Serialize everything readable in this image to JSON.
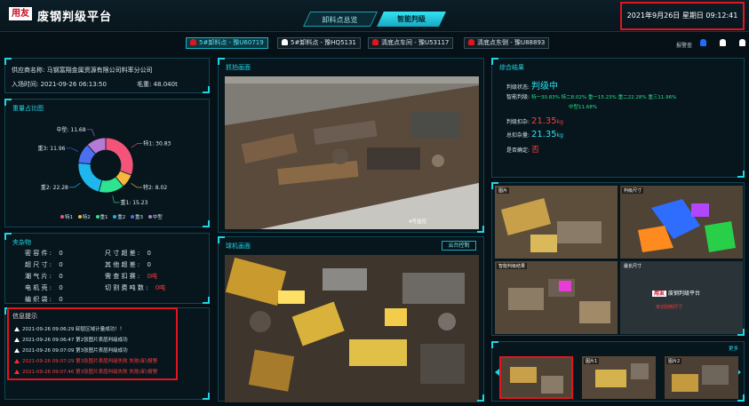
{
  "header": {
    "logo_text": "用友",
    "app_title": "废钢判级平台",
    "tabs": [
      {
        "label": "卸料点总览",
        "active": false
      },
      {
        "label": "智能判级",
        "active": true
      }
    ],
    "datetime": "2021年9月26日   星期日   09:12:41"
  },
  "subbar": {
    "plates": [
      {
        "label": "5#卸料点 - 豫U60719",
        "active": true,
        "bell": "#e3141e"
      },
      {
        "label": "5#卸料点 - 豫HQ5131",
        "active": false,
        "bell": "#ffffff"
      },
      {
        "label": "清底点车间 - 豫U53117",
        "active": false,
        "bell": "#e3141e"
      },
      {
        "label": "清底点东侧 - 豫U88893",
        "active": false,
        "bell": "#e3141e"
      }
    ],
    "right_label": "报警查"
  },
  "supplier": {
    "name_label": "供应商名称:",
    "name_value": "马钢富翔金属资源有限公司料率分公司",
    "time_label": "入场时间:",
    "time_value": "2021-09-26 06:13:50",
    "weight_label": "毛重:",
    "weight_value": "48.040t"
  },
  "ratio_panel": {
    "title": "重量占比图",
    "legend": [
      {
        "name": "特1",
        "color": "#f4537a"
      },
      {
        "name": "特2",
        "color": "#f6b73c"
      },
      {
        "name": "重1",
        "color": "#2ee48f"
      },
      {
        "name": "重2",
        "color": "#1fb6ee"
      },
      {
        "name": "重3",
        "color": "#4a6ff0"
      },
      {
        "name": "中型",
        "color": "#b57ad8"
      }
    ]
  },
  "chart_data": {
    "type": "pie",
    "title": "",
    "categories": [
      "特1",
      "特2",
      "重1",
      "重2",
      "重3",
      "中型"
    ],
    "values": [
      30.83,
      8.02,
      15.23,
      22.28,
      11.96,
      11.68
    ],
    "labels": [
      "特1: 30.83",
      "特2: 8.02",
      "重1: 15.23",
      "重2: 22.28",
      "重3: 11.96",
      "中型: 11.68"
    ],
    "legend": "bottom"
  },
  "inclusions": {
    "title": "夹杂物",
    "items": [
      {
        "label": "密 容 件 :",
        "value": "0",
        "color": "#d5e2e8"
      },
      {
        "label": "尺 寸 超 差 :",
        "value": "0",
        "color": "#d5e2e8"
      },
      {
        "label": "超 尺 寸 :",
        "value": "0",
        "color": "#d5e2e8"
      },
      {
        "label": "其 他 超 差 :",
        "value": "0",
        "color": "#d5e2e8"
      },
      {
        "label": "潮 气 片 :",
        "value": "0",
        "color": "#d5e2e8"
      },
      {
        "label": "需 查 扣 赛 :",
        "value": "0吨",
        "color": "#ff3b3b"
      },
      {
        "label": "电 机 壳 :",
        "value": "0",
        "color": "#d5e2e8"
      },
      {
        "label": "切 割 费 吨 数 :",
        "value": "0吨",
        "color": "#ff3b3b"
      },
      {
        "label": "编 织 袋 :",
        "value": "0",
        "color": "#d5e2e8"
      }
    ]
  },
  "messages": {
    "title": "信息提示",
    "items": [
      {
        "text": "2021-09-26 09:06:29   卸层区域计量成功！！",
        "level": "info"
      },
      {
        "text": "2021-09-26 09:06:47   第2张图片表层判级成功",
        "level": "info"
      },
      {
        "text": "2021-09-26 09:07:09   第3张图片表层判级成功",
        "level": "info"
      },
      {
        "text": "2021-09-26 09:07:29   第3张图片表层判级失败   失败(卸)报警",
        "level": "error"
      },
      {
        "text": "2021-09-26 09:07:46   第3张图片表层判级失败   失败(卸)报警",
        "level": "error"
      }
    ]
  },
  "capture_panel": {
    "title": "抓拍画面",
    "cam_label": "4号监控"
  },
  "live_panel": {
    "title": "球机画面",
    "control_button": "云台控制"
  },
  "result_panel": {
    "title": "综合结果",
    "status_label": "判级状态:",
    "status_value": "判级中",
    "grade_label": "智能判级:",
    "grade_line1": "特一30.83%   特二8.02%   重一15.23%   重二22.28%   重三11.96%",
    "grade_line2": "中型11.68%",
    "deduct_label": "判级扣杂:",
    "deduct_value": "21.35",
    "deduct_unit": "kg",
    "total_label": "总扣杂量:",
    "total_value": "21.35",
    "total_unit": "kg",
    "confirm_label": "是否确定:",
    "confirm_value": "否"
  },
  "analysis": {
    "thumbs": [
      {
        "label": "图片"
      },
      {
        "label": "判级尺寸"
      },
      {
        "label": "智能判级结果"
      }
    ],
    "right_label": "最长尺寸",
    "brand_logo": "用友",
    "brand_title": "废钢判级平台",
    "brand_sub": "未识别到尺寸"
  },
  "gallery": {
    "more_label": "更多",
    "thumbs": [
      {
        "label": ""
      },
      {
        "label": "图片1"
      },
      {
        "label": "图片2"
      }
    ]
  },
  "colors": {
    "accent": "#1fd6e6",
    "alarm_red": "#e3141e",
    "background": "#061117"
  }
}
